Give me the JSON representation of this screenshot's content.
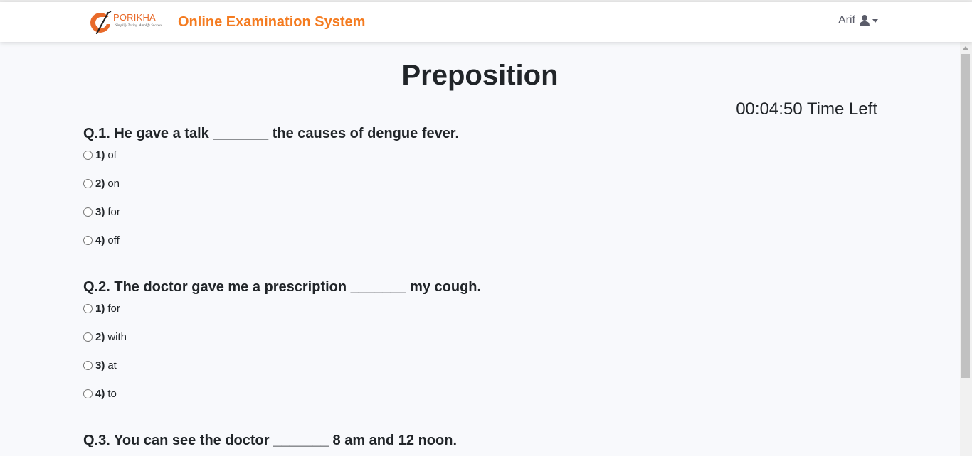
{
  "navbar": {
    "logo_text": "PORIKHA",
    "logo_tagline": "Simplify Taking. Amplify Success",
    "title": "Online Examination System",
    "user_name": "Arif"
  },
  "exam": {
    "title": "Preposition",
    "time_left": "00:04:50",
    "time_label": "Time Left"
  },
  "questions": [
    {
      "text": "Q.1. He gave a talk _______ the causes of dengue fever.",
      "options": [
        {
          "num": "1)",
          "label": "of"
        },
        {
          "num": "2)",
          "label": "on"
        },
        {
          "num": "3)",
          "label": "for"
        },
        {
          "num": "4)",
          "label": "off"
        }
      ]
    },
    {
      "text": "Q.2. The doctor gave me a prescription _______ my cough.",
      "options": [
        {
          "num": "1)",
          "label": "for"
        },
        {
          "num": "2)",
          "label": "with"
        },
        {
          "num": "3)",
          "label": "at"
        },
        {
          "num": "4)",
          "label": "to"
        }
      ]
    },
    {
      "text": "Q.3. You can see the doctor _______ 8 am and 12 noon.",
      "options": []
    }
  ],
  "colors": {
    "brand_orange": "#f47b20",
    "page_bg": "#f8f9fc"
  }
}
